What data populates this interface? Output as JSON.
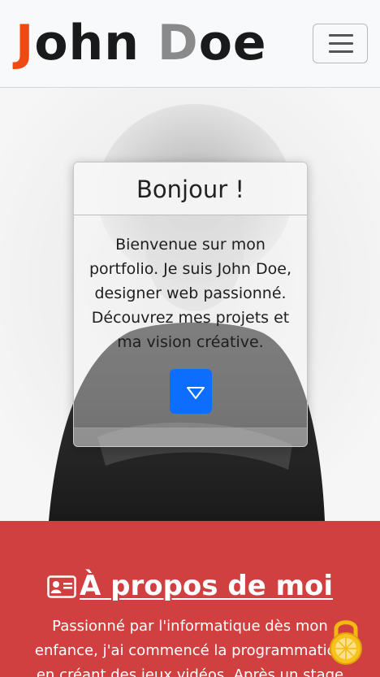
{
  "brand": {
    "first_initial": "J",
    "first_rest": "ohn ",
    "last_initial": "D",
    "last_rest": "oe"
  },
  "nav": {
    "toggler_icon": "hamburger-icon"
  },
  "hero": {
    "card_title": "Bonjour !",
    "card_text": "Bienvenue sur mon portfolio. Je suis John Doe, designer web passionné. Découvrez mes projets et ma vision créative.",
    "scroll_icon": "chevron-down-icon"
  },
  "about": {
    "title_icon": "id-card-icon",
    "title": "À propos de moi",
    "text": "Passionné par l'informatique dès mon enfance, j'ai commencé la programmation en créant des jeux vidéos. Après un stage"
  },
  "overlay": {
    "icon": "lock-icon"
  },
  "colors": {
    "brand_accent": "#f04a14",
    "brand_secondary": "#8a8a8a",
    "primary_button": "#0d6efd",
    "about_bg": "#d04040"
  }
}
